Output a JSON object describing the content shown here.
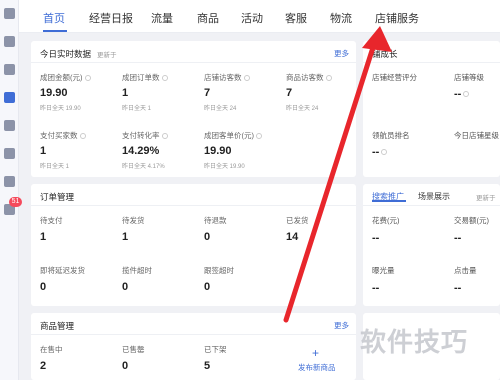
{
  "nav": {
    "tabs": [
      {
        "label": "首页",
        "active": true
      },
      {
        "label": "经营日报"
      },
      {
        "label": "流量"
      },
      {
        "label": "商品"
      },
      {
        "label": "活动"
      },
      {
        "label": "客服"
      },
      {
        "label": "物流"
      },
      {
        "label": "店铺服务"
      }
    ],
    "rail_icons": [
      "message-icon",
      "document-icon",
      "bag-icon",
      "chart-icon",
      "grid-icon",
      "shield-icon",
      "note-icon",
      "speaker-icon"
    ],
    "notification_count": "51"
  },
  "realtime": {
    "title": "今日实时数据",
    "subtitle": "更新于",
    "more": "更多",
    "metrics": [
      {
        "label": "成团金额(元)",
        "value": "19.90",
        "yesterday": "昨日全天 19.90"
      },
      {
        "label": "成团订单数",
        "value": "1",
        "yesterday": "昨日全天 1"
      },
      {
        "label": "店铺访客数",
        "value": "7",
        "yesterday": "昨日全天 24"
      },
      {
        "label": "商品访客数",
        "value": "7",
        "yesterday": "昨日全天 24"
      },
      {
        "label": "支付买家数",
        "value": "1",
        "yesterday": "昨日全天 1"
      },
      {
        "label": "支付转化率",
        "value": "14.29%",
        "yesterday": "昨日全天 4.17%"
      },
      {
        "label": "成团客单价(元)",
        "value": "19.90",
        "yesterday": "昨日全天 19.90"
      }
    ]
  },
  "orders": {
    "title": "订单管理",
    "items": [
      {
        "label": "待支付",
        "value": "1"
      },
      {
        "label": "待发货",
        "value": "1"
      },
      {
        "label": "待退款",
        "value": "0"
      },
      {
        "label": "已发货",
        "value": "14"
      },
      {
        "label": "即将延迟发货",
        "value": "0"
      },
      {
        "label": "揽件超时",
        "value": "0"
      },
      {
        "label": "跟签超时",
        "value": "0"
      }
    ]
  },
  "products": {
    "title": "商品管理",
    "more": "更多",
    "items": [
      {
        "label": "在售中",
        "value": "2"
      },
      {
        "label": "已售罄",
        "value": "0"
      },
      {
        "label": "已下架",
        "value": "5"
      }
    ],
    "publish_label": "发布新商品"
  },
  "growth": {
    "title": "铺成长",
    "score_label": "店铺经营评分",
    "level_label": "店铺等级",
    "level_value": "--",
    "rank_label": "领航员排名",
    "rank_value": "--",
    "today_label": "今日店铺星级"
  },
  "promo": {
    "tabs": [
      {
        "label": "搜索推广",
        "active": true
      },
      {
        "label": "场景展示"
      }
    ],
    "update_label": "更新于",
    "spend_label": "花费(元)",
    "spend_value": "--",
    "trade_label": "交易额(元)",
    "trade_value": "--",
    "impressions_label": "曝光量",
    "impressions_value": "--",
    "clicks_label": "点击量",
    "clicks_value": "--"
  },
  "watermark": "软件技巧",
  "colors": {
    "accent": "#3f6dd6",
    "arrow": "#e8262c",
    "badge": "#f5495b"
  }
}
